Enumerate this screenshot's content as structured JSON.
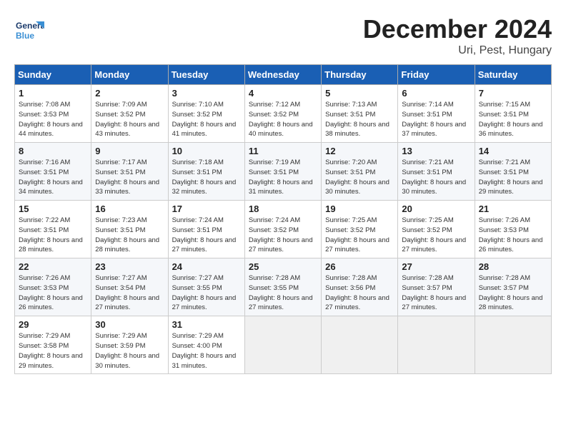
{
  "header": {
    "logo_text_general": "General",
    "logo_text_blue": "Blue",
    "month_year": "December 2024",
    "location": "Uri, Pest, Hungary"
  },
  "weekdays": [
    "Sunday",
    "Monday",
    "Tuesday",
    "Wednesday",
    "Thursday",
    "Friday",
    "Saturday"
  ],
  "weeks": [
    [
      {
        "day": "1",
        "sunrise": "Sunrise: 7:08 AM",
        "sunset": "Sunset: 3:53 PM",
        "daylight": "Daylight: 8 hours and 44 minutes."
      },
      {
        "day": "2",
        "sunrise": "Sunrise: 7:09 AM",
        "sunset": "Sunset: 3:52 PM",
        "daylight": "Daylight: 8 hours and 43 minutes."
      },
      {
        "day": "3",
        "sunrise": "Sunrise: 7:10 AM",
        "sunset": "Sunset: 3:52 PM",
        "daylight": "Daylight: 8 hours and 41 minutes."
      },
      {
        "day": "4",
        "sunrise": "Sunrise: 7:12 AM",
        "sunset": "Sunset: 3:52 PM",
        "daylight": "Daylight: 8 hours and 40 minutes."
      },
      {
        "day": "5",
        "sunrise": "Sunrise: 7:13 AM",
        "sunset": "Sunset: 3:51 PM",
        "daylight": "Daylight: 8 hours and 38 minutes."
      },
      {
        "day": "6",
        "sunrise": "Sunrise: 7:14 AM",
        "sunset": "Sunset: 3:51 PM",
        "daylight": "Daylight: 8 hours and 37 minutes."
      },
      {
        "day": "7",
        "sunrise": "Sunrise: 7:15 AM",
        "sunset": "Sunset: 3:51 PM",
        "daylight": "Daylight: 8 hours and 36 minutes."
      }
    ],
    [
      {
        "day": "8",
        "sunrise": "Sunrise: 7:16 AM",
        "sunset": "Sunset: 3:51 PM",
        "daylight": "Daylight: 8 hours and 34 minutes."
      },
      {
        "day": "9",
        "sunrise": "Sunrise: 7:17 AM",
        "sunset": "Sunset: 3:51 PM",
        "daylight": "Daylight: 8 hours and 33 minutes."
      },
      {
        "day": "10",
        "sunrise": "Sunrise: 7:18 AM",
        "sunset": "Sunset: 3:51 PM",
        "daylight": "Daylight: 8 hours and 32 minutes."
      },
      {
        "day": "11",
        "sunrise": "Sunrise: 7:19 AM",
        "sunset": "Sunset: 3:51 PM",
        "daylight": "Daylight: 8 hours and 31 minutes."
      },
      {
        "day": "12",
        "sunrise": "Sunrise: 7:20 AM",
        "sunset": "Sunset: 3:51 PM",
        "daylight": "Daylight: 8 hours and 30 minutes."
      },
      {
        "day": "13",
        "sunrise": "Sunrise: 7:21 AM",
        "sunset": "Sunset: 3:51 PM",
        "daylight": "Daylight: 8 hours and 30 minutes."
      },
      {
        "day": "14",
        "sunrise": "Sunrise: 7:21 AM",
        "sunset": "Sunset: 3:51 PM",
        "daylight": "Daylight: 8 hours and 29 minutes."
      }
    ],
    [
      {
        "day": "15",
        "sunrise": "Sunrise: 7:22 AM",
        "sunset": "Sunset: 3:51 PM",
        "daylight": "Daylight: 8 hours and 28 minutes."
      },
      {
        "day": "16",
        "sunrise": "Sunrise: 7:23 AM",
        "sunset": "Sunset: 3:51 PM",
        "daylight": "Daylight: 8 hours and 28 minutes."
      },
      {
        "day": "17",
        "sunrise": "Sunrise: 7:24 AM",
        "sunset": "Sunset: 3:51 PM",
        "daylight": "Daylight: 8 hours and 27 minutes."
      },
      {
        "day": "18",
        "sunrise": "Sunrise: 7:24 AM",
        "sunset": "Sunset: 3:52 PM",
        "daylight": "Daylight: 8 hours and 27 minutes."
      },
      {
        "day": "19",
        "sunrise": "Sunrise: 7:25 AM",
        "sunset": "Sunset: 3:52 PM",
        "daylight": "Daylight: 8 hours and 27 minutes."
      },
      {
        "day": "20",
        "sunrise": "Sunrise: 7:25 AM",
        "sunset": "Sunset: 3:52 PM",
        "daylight": "Daylight: 8 hours and 27 minutes."
      },
      {
        "day": "21",
        "sunrise": "Sunrise: 7:26 AM",
        "sunset": "Sunset: 3:53 PM",
        "daylight": "Daylight: 8 hours and 26 minutes."
      }
    ],
    [
      {
        "day": "22",
        "sunrise": "Sunrise: 7:26 AM",
        "sunset": "Sunset: 3:53 PM",
        "daylight": "Daylight: 8 hours and 26 minutes."
      },
      {
        "day": "23",
        "sunrise": "Sunrise: 7:27 AM",
        "sunset": "Sunset: 3:54 PM",
        "daylight": "Daylight: 8 hours and 27 minutes."
      },
      {
        "day": "24",
        "sunrise": "Sunrise: 7:27 AM",
        "sunset": "Sunset: 3:55 PM",
        "daylight": "Daylight: 8 hours and 27 minutes."
      },
      {
        "day": "25",
        "sunrise": "Sunrise: 7:28 AM",
        "sunset": "Sunset: 3:55 PM",
        "daylight": "Daylight: 8 hours and 27 minutes."
      },
      {
        "day": "26",
        "sunrise": "Sunrise: 7:28 AM",
        "sunset": "Sunset: 3:56 PM",
        "daylight": "Daylight: 8 hours and 27 minutes."
      },
      {
        "day": "27",
        "sunrise": "Sunrise: 7:28 AM",
        "sunset": "Sunset: 3:57 PM",
        "daylight": "Daylight: 8 hours and 27 minutes."
      },
      {
        "day": "28",
        "sunrise": "Sunrise: 7:28 AM",
        "sunset": "Sunset: 3:57 PM",
        "daylight": "Daylight: 8 hours and 28 minutes."
      }
    ],
    [
      {
        "day": "29",
        "sunrise": "Sunrise: 7:29 AM",
        "sunset": "Sunset: 3:58 PM",
        "daylight": "Daylight: 8 hours and 29 minutes."
      },
      {
        "day": "30",
        "sunrise": "Sunrise: 7:29 AM",
        "sunset": "Sunset: 3:59 PM",
        "daylight": "Daylight: 8 hours and 30 minutes."
      },
      {
        "day": "31",
        "sunrise": "Sunrise: 7:29 AM",
        "sunset": "Sunset: 4:00 PM",
        "daylight": "Daylight: 8 hours and 31 minutes."
      },
      null,
      null,
      null,
      null
    ]
  ]
}
